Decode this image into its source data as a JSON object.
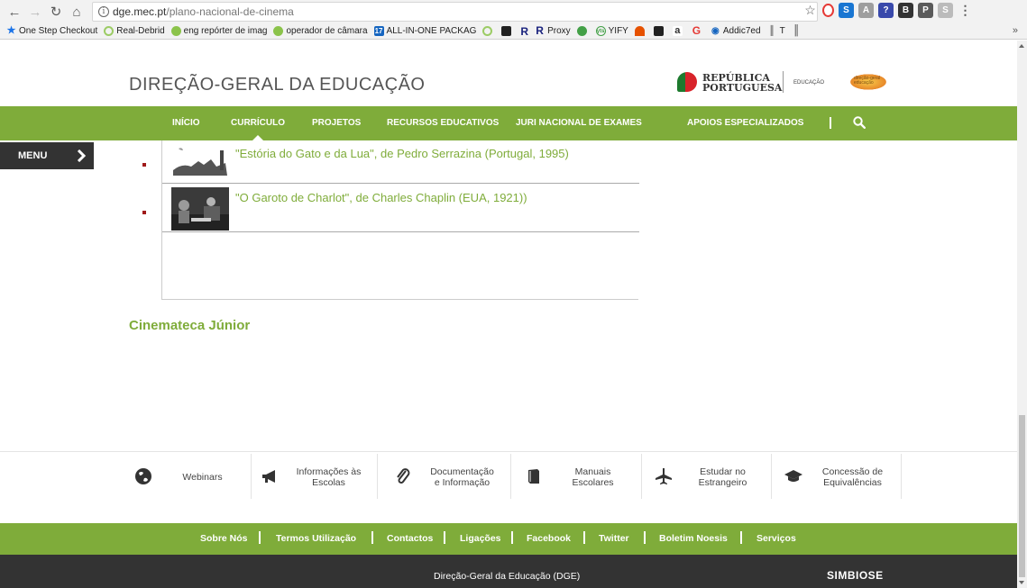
{
  "browser": {
    "url_domain": "dge.mec.pt",
    "url_path": "/plano-nacional-de-cinema",
    "bookmarks": [
      {
        "label": "One Step Checkout",
        "icon": "star-icon",
        "color": "#1a73e8"
      },
      {
        "label": "Real-Debrid",
        "icon": "circle-icon",
        "color": "#9ccc65"
      },
      {
        "label": "eng repórter de imag",
        "icon": "globe-icon",
        "color": "#8bc34a"
      },
      {
        "label": "operador de câmara",
        "icon": "globe-icon",
        "color": "#8bc34a"
      },
      {
        "label": "ALL-IN-ONE PACKAG",
        "icon": "calendar-icon",
        "color": "#1565c0"
      },
      {
        "label": "R",
        "icon": "circle-icon",
        "color": "#9ccc65"
      },
      {
        "label": "R",
        "icon": "r-icon",
        "color": "#1a237e"
      },
      {
        "label": "Proxy",
        "icon": "r-icon",
        "color": "#1a237e"
      },
      {
        "label": "YIFY",
        "icon": "shield-icon",
        "color": "#43a047"
      },
      {
        "label": "Addic7ed",
        "icon": "eye-icon",
        "color": "#1565c0"
      },
      {
        "label": "T",
        "icon": "books-icon",
        "color": "#333333"
      }
    ],
    "more": "»"
  },
  "header": {
    "logo": "DIREÇÃO-GERAL DA EDUCAÇÃO",
    "republica_line1": "REPÚBLICA",
    "republica_line2": "PORTUGUESA",
    "ministry": "EDUCAÇÃO",
    "dge_logo_line1": "direção-geral",
    "dge_logo_line2": "educação"
  },
  "nav": {
    "items": [
      "INÍCIO",
      "CURRÍCULO",
      "PROJETOS",
      "RECURSOS EDUCATIVOS",
      "JURI NACIONAL DE EXAMES",
      "APOIOS ESPECIALIZADOS"
    ],
    "active_index": 1
  },
  "menu": {
    "label": "MENU"
  },
  "films": [
    {
      "title": "\"Estória do Gato e da Lua\", de Pedro Serrazina (Portugal, 1995)"
    },
    {
      "title": "\"O Garoto de Charlot\", de Charles Chaplin (EUA, 1921))"
    }
  ],
  "section_title": "Cinemateca Júnior",
  "quick_links": [
    {
      "label": "Webinars",
      "icon": "globe-icon"
    },
    {
      "label": "Informações às\nEscolas",
      "icon": "megaphone-icon"
    },
    {
      "label": "Documentação\ne Informação",
      "icon": "paperclip-icon"
    },
    {
      "label": "Manuais\nEscolares",
      "icon": "book-icon"
    },
    {
      "label": "Estudar no\nEstrangeiro",
      "icon": "airplane-icon"
    },
    {
      "label": "Concessão de\nEquivalências",
      "icon": "graduation-cap-icon"
    }
  ],
  "footer": {
    "links": [
      "Sobre Nós",
      "Termos Utilização",
      "Contactos",
      "Ligações",
      "Facebook",
      "Twitter",
      "Boletim Noesis",
      "Serviços"
    ],
    "org": "Direção-Geral da Educação (DGE)",
    "brand": "SIMBIOSE"
  },
  "colors": {
    "green": "#7fac3a",
    "dark": "#333333",
    "bullet": "#a01a1a"
  }
}
